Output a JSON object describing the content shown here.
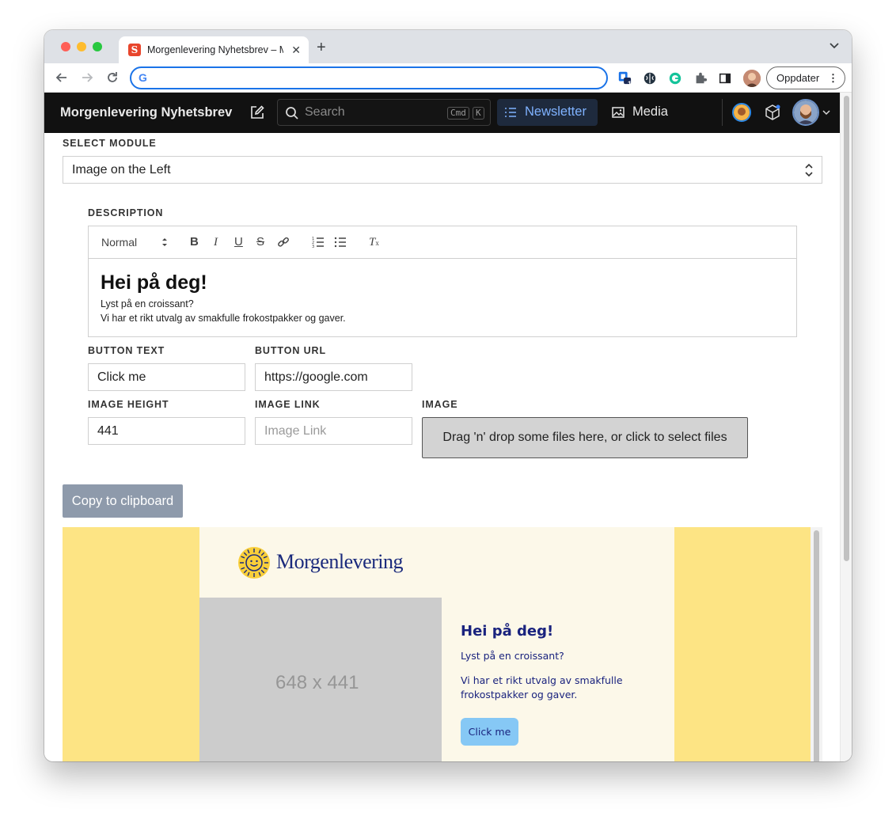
{
  "browser": {
    "tab_title": "Morgenlevering Nyhetsbrev – M",
    "tab_favicon_letter": "S",
    "address_value": "",
    "update_label": "Oppdater",
    "ext_badge": "1"
  },
  "app": {
    "brand": "Morgenlevering Nyhetsbrev",
    "search_placeholder": "Search",
    "shortcut_mod": "Cmd",
    "shortcut_key": "K",
    "nav": {
      "newsletter": "Newsletter",
      "media": "Media"
    }
  },
  "form": {
    "select_module_label": "SELECT MODULE",
    "select_module_value": "Image on the Left",
    "description_label": "DESCRIPTION",
    "editor_toolbar": {
      "format": "Normal"
    },
    "editor_content": {
      "heading": "Hei på deg!",
      "line1": "Lyst på en croissant?",
      "line2": "Vi har et rikt utvalg av smakfulle frokostpakker og gaver."
    },
    "button_text_label": "BUTTON TEXT",
    "button_text_value": "Click me",
    "button_url_label": "BUTTON URL",
    "button_url_value": "https://google.com",
    "image_height_label": "IMAGE HEIGHT",
    "image_height_value": "441",
    "image_link_label": "IMAGE LINK",
    "image_link_placeholder": "Image Link",
    "image_label": "IMAGE",
    "dropzone_text": "Drag 'n' drop some files here, or click to select files",
    "copy_button": "Copy to clipboard"
  },
  "preview": {
    "logo_text": "Morgenlevering",
    "placeholder_text": "648 x 441",
    "title": "Hei på deg!",
    "line1": "Lyst på en croissant?",
    "line2": "Vi har et rikt utvalg av smakfulle frokostpakker og gaver.",
    "button": "Click me"
  },
  "colors": {
    "header_bg": "#111111",
    "accent_blue": "#7fb2ff",
    "preview_yellow": "#fde484",
    "preview_navy": "#1a237e",
    "preview_button": "#86c8f5"
  }
}
